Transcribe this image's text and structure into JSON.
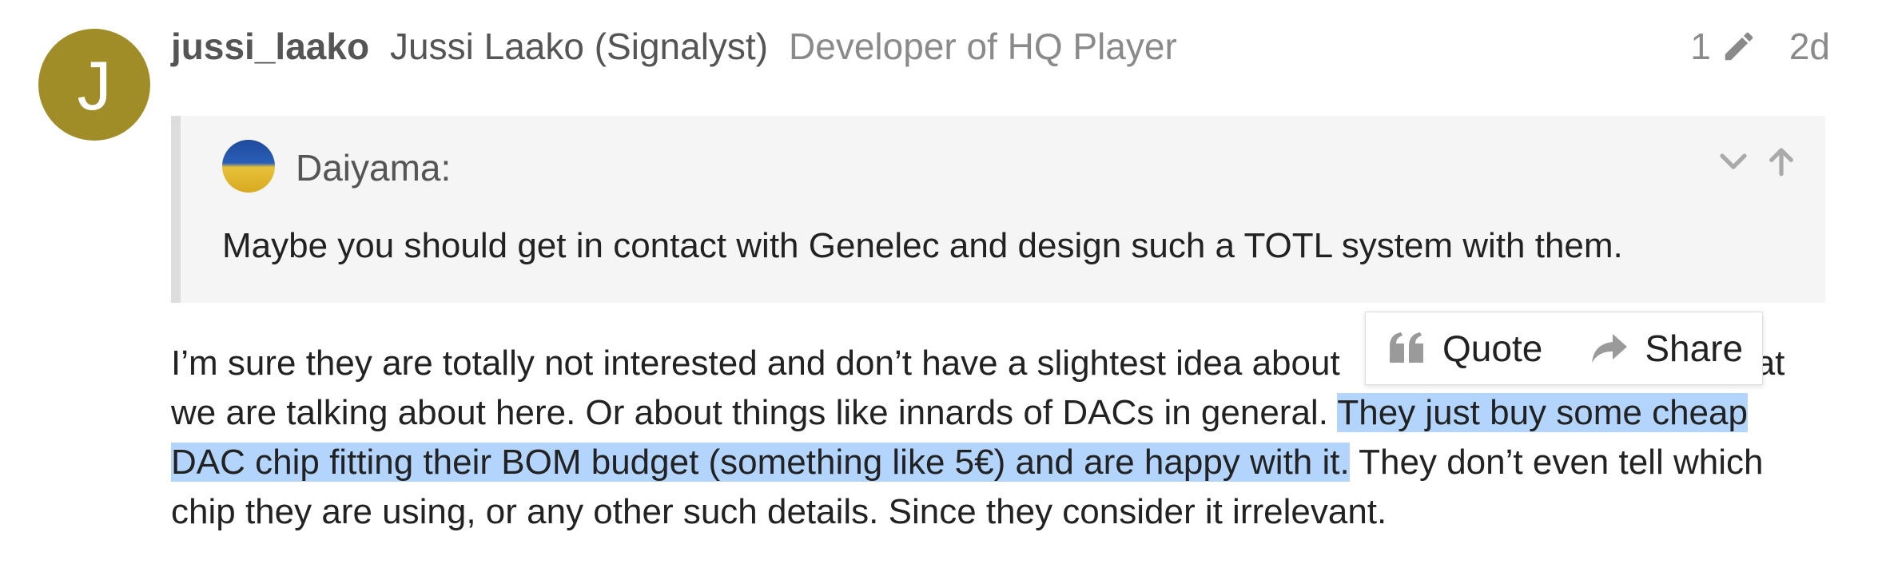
{
  "post": {
    "avatar_letter": "J",
    "avatar_color": "#a08d28",
    "username": "jussi_laako",
    "full_name": "Jussi Laako (Signalyst)",
    "user_title": "Developer of HQ Player",
    "edit_count": "1",
    "date": "2d"
  },
  "quote": {
    "author": "Daiyama:",
    "text": "Maybe you should get in contact with Genelec and design such a TOTL system with them."
  },
  "body": {
    "line1_a": "I’m sure they are totally not interested and don’t have a slightest idea about",
    "line1_b": "at",
    "line2_a": "we are talking about here. Or about things like innards of DACs in general. ",
    "line2_b": "They just buy some cheap",
    "line3_a": "DAC chip fitting their BOM budget (something like 5€) and are happy with it.",
    "line3_b": " They don’t even tell which",
    "line4": "chip they are using, or any other such details. Since they consider it irrelevant."
  },
  "popup": {
    "quote_label": "Quote",
    "share_label": "Share"
  },
  "colors": {
    "selection": "#b3d4fc",
    "quote_bg": "#f5f5f5",
    "quote_border": "#dddddd"
  }
}
